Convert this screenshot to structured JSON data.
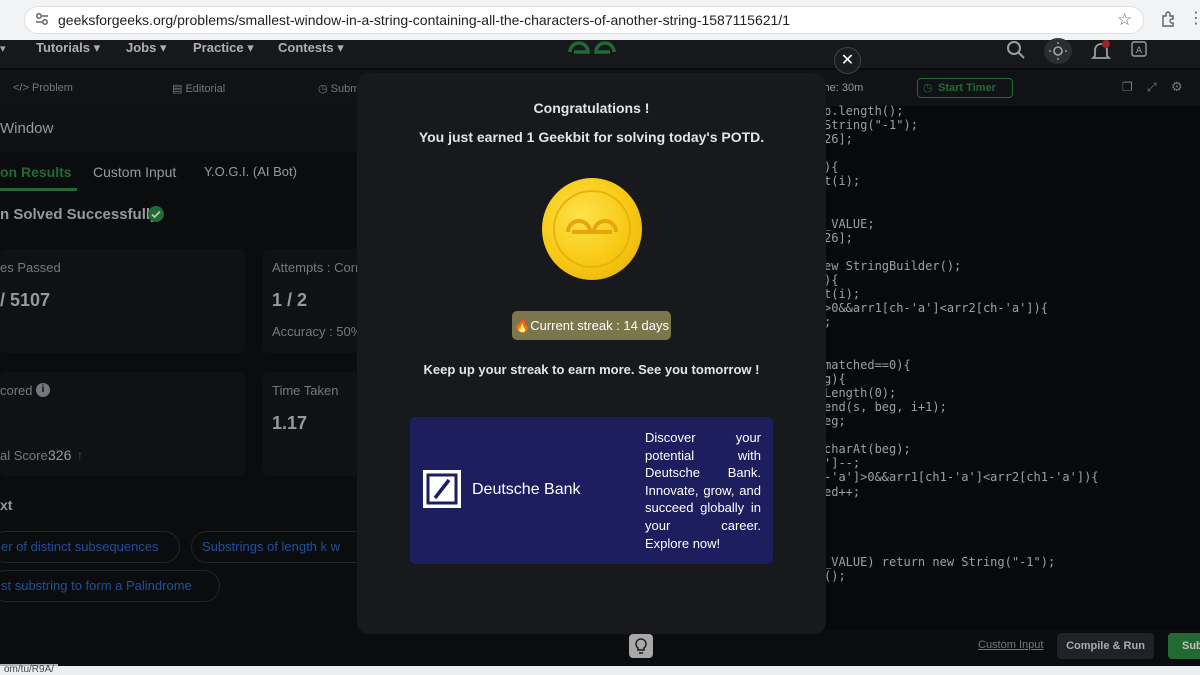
{
  "browser": {
    "url": "geeksforgeeks.org/problems/smallest-window-in-a-string-containing-all-the-characters-of-another-string-1587115621/1",
    "status_url": "om/tu/R9A/"
  },
  "nav": {
    "items": [
      "Tutorials",
      "Jobs",
      "Practice",
      "Contests"
    ]
  },
  "tabs": {
    "problem": "</> Problem",
    "editorial": "Editorial",
    "submissions": "Subm",
    "timer_text": "ime: 30m",
    "start_timer": "Start Timer"
  },
  "left": {
    "title": "Window",
    "result_tabs": [
      "on Results",
      "Custom Input",
      "Y.O.G.I. (AI Bot)"
    ],
    "solved_text": "n Solved Successfully",
    "cases_label": "es Passed",
    "cases_value": "/ 5107",
    "attempts_label": "Attempts : Corr",
    "attempts_value": "1 / 2",
    "accuracy_label": "Accuracy : 50%",
    "scored_label": "cored",
    "total_score_label": "al Score:",
    "total_score_value": "326",
    "time_label": "Time Taken",
    "time_value": "1.17",
    "next_label": "xt",
    "chips": [
      "er of distinct subsequences",
      "Substrings of length k w",
      "st substring to form a Palindrome"
    ]
  },
  "editor": {
    "code_lines": [
      "p.length();",
      "String(\"-1\");",
      "26];",
      "",
      "){",
      "t(i);",
      "",
      "",
      "_VALUE;",
      "26];",
      "",
      "ew StringBuilder();",
      "){",
      "t(i);",
      ">0&&arr1[ch-'a']<arr2[ch-'a']){",
      ";",
      "",
      "",
      "matched==0){",
      "g){",
      "Length(0);",
      "end(s, beg, i+1);",
      "eg;",
      "",
      "charAt(beg);",
      "']--;",
      "-'a']>0&&arr1[ch1-'a']<arr2[ch1-'a']){",
      "ed++;",
      "",
      "",
      "",
      "",
      "_VALUE) return new String(\"-1\");",
      "();"
    ],
    "custom_input": "Custom Input",
    "compile_run": "Compile & Run",
    "submit": "Sub"
  },
  "modal": {
    "title": "Congratulations !",
    "subtitle": "You just earned 1 Geekbit for solving today's POTD.",
    "streak": "Current streak : 14 days",
    "keep_up": "Keep up your streak to earn more. See you tomorrow !",
    "ad_brand": "Deutsche Bank",
    "ad_text": "Discover your potential with Deutsche Bank. Innovate, grow, and succeed globally in your career. Explore now!"
  },
  "colors": {
    "accent_green": "#2f8d46",
    "coin": "#f7c813",
    "ad_bg": "#1c1e5d",
    "link_blue": "#2c6ad1"
  }
}
